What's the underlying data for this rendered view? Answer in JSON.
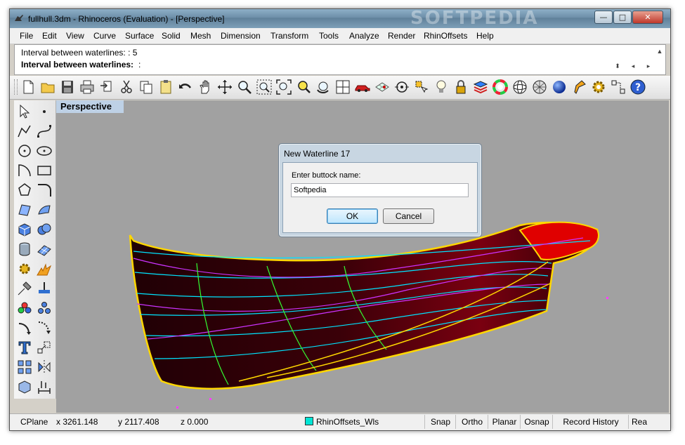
{
  "window": {
    "title": "fullhull.3dm - Rhinoceros (Evaluation) - [Perspective]",
    "watermark": "SOFTPEDIA",
    "minimize_label": "—",
    "maximize_label": "□",
    "close_label": "✕"
  },
  "menu": {
    "items": [
      "File",
      "Edit",
      "View",
      "Curve",
      "Surface",
      "Solid",
      "Mesh",
      "Dimension",
      "Transform",
      "Tools",
      "Analyze",
      "Render",
      "RhinOffsets",
      "Help"
    ]
  },
  "command": {
    "history": "Interval between waterlines: : 5",
    "prompt": "Interval between waterlines:",
    "prompt_suffix": ":"
  },
  "toolbar": {
    "icons": [
      "new-icon",
      "open-icon",
      "save-icon",
      "print-icon",
      "import-icon",
      "cut-icon",
      "copy-icon",
      "paste-icon",
      "undo-icon",
      "pan-icon",
      "rotate-icon",
      "zoom-icon",
      "zoom-window-icon",
      "zoom-extents-icon",
      "zoom-selected-icon",
      "undo-view-icon",
      "four-viewports-icon",
      "car-icon",
      "grid-icon",
      "object-snap-icon",
      "select-icon",
      "light-icon",
      "lock-icon",
      "layer-icon",
      "color-wheel-icon",
      "sphere-wire-icon",
      "mesh-sphere-icon",
      "render-sphere-icon",
      "spotlight-icon",
      "gear-icon",
      "options-icon",
      "help-icon"
    ]
  },
  "viewport": {
    "label": "Perspective"
  },
  "dialog": {
    "title": "New Waterline 17",
    "prompt": "Enter buttock name:",
    "value": "Softpedia",
    "ok_label": "OK",
    "cancel_label": "Cancel"
  },
  "status": {
    "cplane": "CPlane",
    "x": "x 3261.148",
    "y": "y 2117.408",
    "z": "z 0.000",
    "layer": "RhinOffsets_Wls",
    "layer_color": "#00e5d5",
    "toggles": [
      "Snap",
      "Ortho",
      "Planar",
      "Osnap",
      "Record History",
      "Rea"
    ]
  },
  "colors": {
    "hull_fill": "#2a0008",
    "hull_outline": "#ffd700",
    "waterlines": "#00e5ff",
    "buttocks": "#cc33ff",
    "sections": "#33ff33",
    "deck_fill": "#e00000",
    "viewport_bg": "#a1a1a1"
  }
}
